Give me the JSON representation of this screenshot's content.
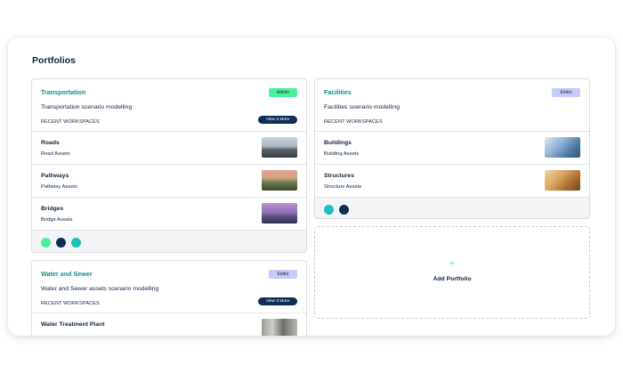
{
  "page": {
    "title": "Portfolios"
  },
  "portfolios": [
    {
      "name": "Transportation",
      "role": "Admin",
      "description": "Transportation scenario modelling",
      "recent_label": "RECENT WORKSPACES",
      "more_label": "View 2 More",
      "workspaces": [
        {
          "name": "Roads",
          "subtitle": "Road Assets",
          "thumb": "road-photo"
        },
        {
          "name": "Pathways",
          "subtitle": "Pathway Assets",
          "thumb": "pathway-photo"
        },
        {
          "name": "Bridges",
          "subtitle": "Bridge Assets",
          "thumb": "bridge-photo"
        }
      ],
      "member_colors": [
        "#4df09a",
        "#0f2e55",
        "#1cc1bd"
      ]
    },
    {
      "name": "Facilities",
      "role": "Editor",
      "description": "Facilities scenario modelling",
      "recent_label": "RECENT WORKSPACES",
      "workspaces": [
        {
          "name": "Buildings",
          "subtitle": "Building Assets",
          "thumb": "building-photo"
        },
        {
          "name": "Structures",
          "subtitle": "Structure Assets",
          "thumb": "structure-photo"
        }
      ],
      "member_colors": [
        "#1cc1bd",
        "#0f2e55"
      ]
    },
    {
      "name": "Water and Sewer",
      "role": "Editor",
      "description": "Water and Sewer assets scenario modelling",
      "recent_label": "RECENT WORKSPACES",
      "more_label": "View 3 More",
      "workspaces": [
        {
          "name": "Water Treatment Plant",
          "subtitle": "",
          "thumb": "plant-photo"
        }
      ]
    }
  ],
  "add_portfolio": {
    "icon": "plus-icon",
    "label": "Add Portfolio"
  },
  "colors": {
    "accent_teal": "#128f83",
    "navy": "#0f2540",
    "admin_badge": "#4df09a",
    "editor_badge": "#c7cbf7"
  }
}
